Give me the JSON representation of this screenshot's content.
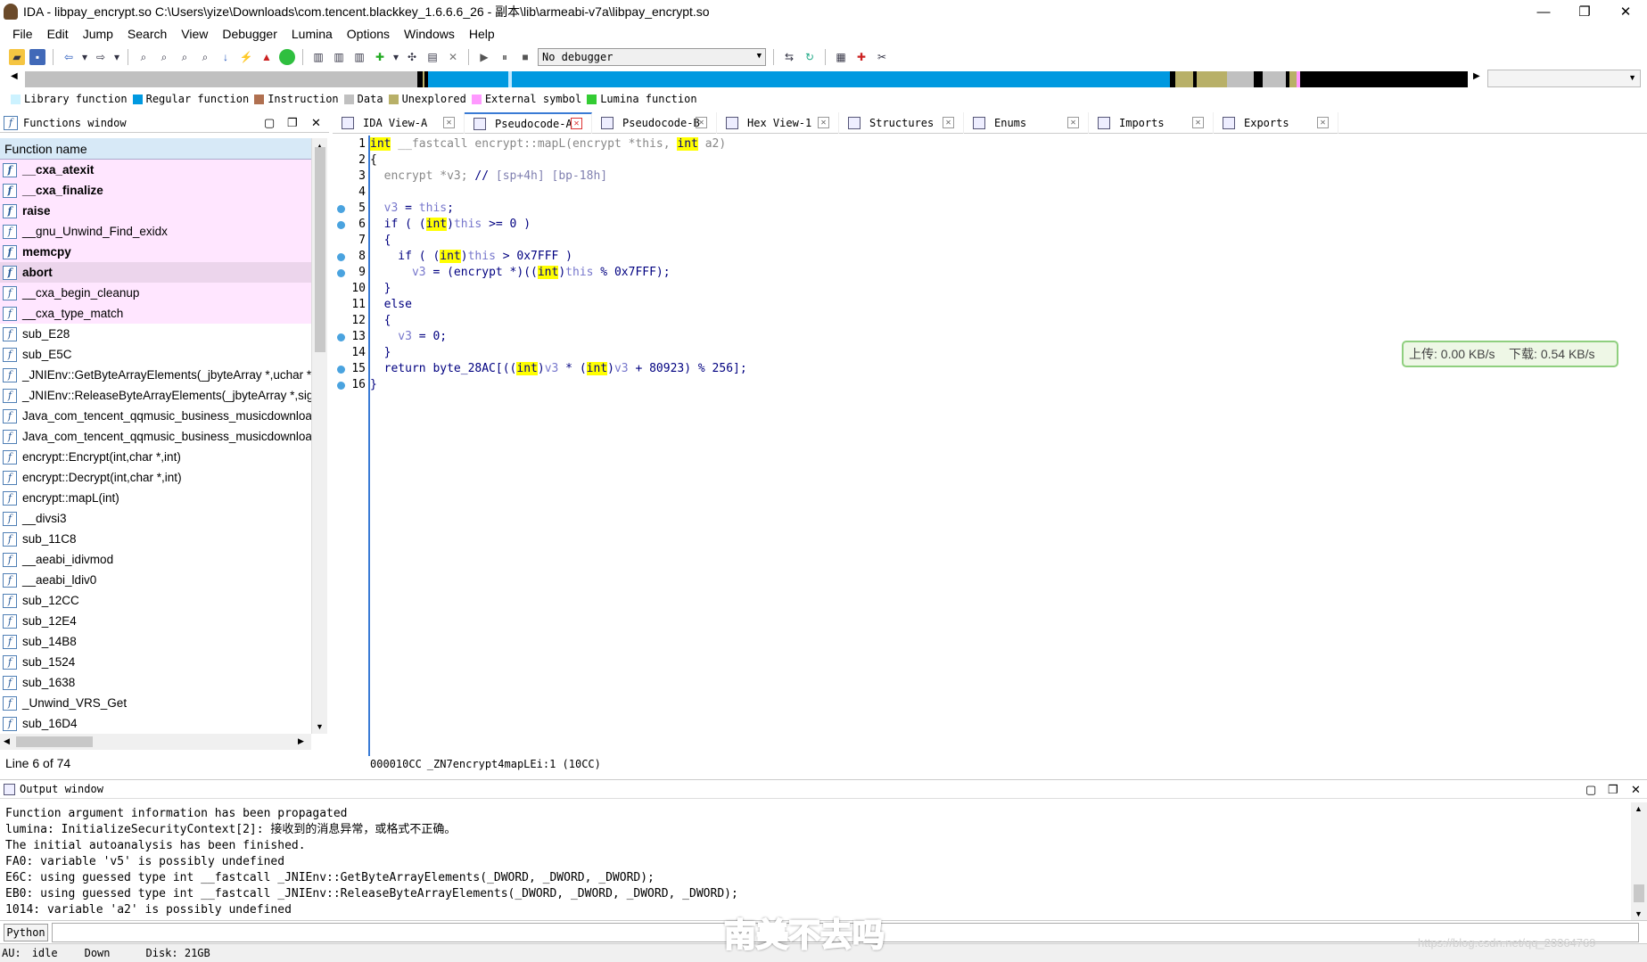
{
  "window": {
    "title": "IDA - libpay_encrypt.so C:\\Users\\yize\\Downloads\\com.tencent.blackkey_1.6.6.6_26 - 副本\\lib\\armeabi-v7a\\libpay_encrypt.so",
    "minimize": "—",
    "restore": "❐",
    "close": "✕"
  },
  "menu": [
    "File",
    "Edit",
    "Jump",
    "Search",
    "View",
    "Debugger",
    "Lumina",
    "Options",
    "Windows",
    "Help"
  ],
  "toolbar": {
    "debugger_value": "No debugger"
  },
  "legend": [
    {
      "label": "Library function",
      "color": "#ccf2ff"
    },
    {
      "label": "Regular function",
      "color": "#0099e0"
    },
    {
      "label": "Instruction",
      "color": "#b07050"
    },
    {
      "label": "Data",
      "color": "#c0c0c0"
    },
    {
      "label": "Unexplored",
      "color": "#b8b068"
    },
    {
      "label": "External symbol",
      "color": "#ff99ff"
    },
    {
      "label": "Lumina function",
      "color": "#33cc33"
    }
  ],
  "functions": {
    "title": "Functions window",
    "column": "Function name",
    "items": [
      {
        "name": "__cxa_atexit",
        "lib": true,
        "bold": true
      },
      {
        "name": "__cxa_finalize",
        "lib": true,
        "bold": true
      },
      {
        "name": "raise",
        "lib": true,
        "bold": true
      },
      {
        "name": "__gnu_Unwind_Find_exidx",
        "lib": true,
        "bold": false
      },
      {
        "name": "memcpy",
        "lib": true,
        "bold": true
      },
      {
        "name": "abort",
        "lib": true,
        "bold": true,
        "selected": true
      },
      {
        "name": "__cxa_begin_cleanup",
        "lib": true,
        "bold": false
      },
      {
        "name": "__cxa_type_match",
        "lib": true,
        "bold": false
      },
      {
        "name": "sub_E28"
      },
      {
        "name": "sub_E5C"
      },
      {
        "name": "_JNIEnv::GetByteArrayElements(_jbyteArray *,uchar *"
      },
      {
        "name": "_JNIEnv::ReleaseByteArrayElements(_jbyteArray *,sigr"
      },
      {
        "name": "Java_com_tencent_qqmusic_business_musicdownloa"
      },
      {
        "name": "Java_com_tencent_qqmusic_business_musicdownloa"
      },
      {
        "name": "encrypt::Encrypt(int,char *,int)"
      },
      {
        "name": "encrypt::Decrypt(int,char *,int)"
      },
      {
        "name": "encrypt::mapL(int)"
      },
      {
        "name": "__divsi3"
      },
      {
        "name": "sub_11C8"
      },
      {
        "name": "__aeabi_idivmod"
      },
      {
        "name": "__aeabi_ldiv0"
      },
      {
        "name": "sub_12CC"
      },
      {
        "name": "sub_12E4"
      },
      {
        "name": "sub_14B8"
      },
      {
        "name": "sub_1524"
      },
      {
        "name": "sub_1638"
      },
      {
        "name": "_Unwind_VRS_Get"
      },
      {
        "name": "sub_16D4"
      }
    ],
    "status": "Line 6 of 74"
  },
  "tabs": [
    {
      "label": "IDA View-A"
    },
    {
      "label": "Pseudocode-A",
      "active": true
    },
    {
      "label": "Pseudocode-B"
    },
    {
      "label": "Hex View-1"
    },
    {
      "label": "Structures"
    },
    {
      "label": "Enums"
    },
    {
      "label": "Imports"
    },
    {
      "label": "Exports"
    }
  ],
  "code": {
    "line_numbers": [
      "1",
      "2",
      "3",
      "4",
      "5",
      "6",
      "7",
      "8",
      "9",
      "10",
      "11",
      "12",
      "13",
      "14",
      "15",
      "16"
    ],
    "status_addr": "000010CC",
    "status_loc": "_ZN7encrypt4mapLEi:1 (10CC)"
  },
  "netspeed": "上传: 0.00 KB/s    下载: 0.54 KB/s",
  "output": {
    "title": "Output window",
    "lines": [
      "Function argument information has been propagated",
      "lumina: InitializeSecurityContext[2]: 接收到的消息异常，或格式不正确。",
      "The initial autoanalysis has been finished.",
      "FA0: variable 'v5' is possibly undefined",
      "E6C: using guessed type int __fastcall _JNIEnv::GetByteArrayElements(_DWORD, _DWORD, _DWORD);",
      "EB0: using guessed type int __fastcall _JNIEnv::ReleaseByteArrayElements(_DWORD, _DWORD, _DWORD, _DWORD);",
      "1014: variable 'a2' is possibly undefined"
    ]
  },
  "python_button": "Python",
  "statusbar": {
    "au_label": "AU:",
    "au_value": "idle",
    "direction": "Down",
    "disk": "Disk: 21GB"
  },
  "overlay_subtitle": "南美不去吗",
  "watermark": "https://blog.csdn.net/qq_23364769"
}
